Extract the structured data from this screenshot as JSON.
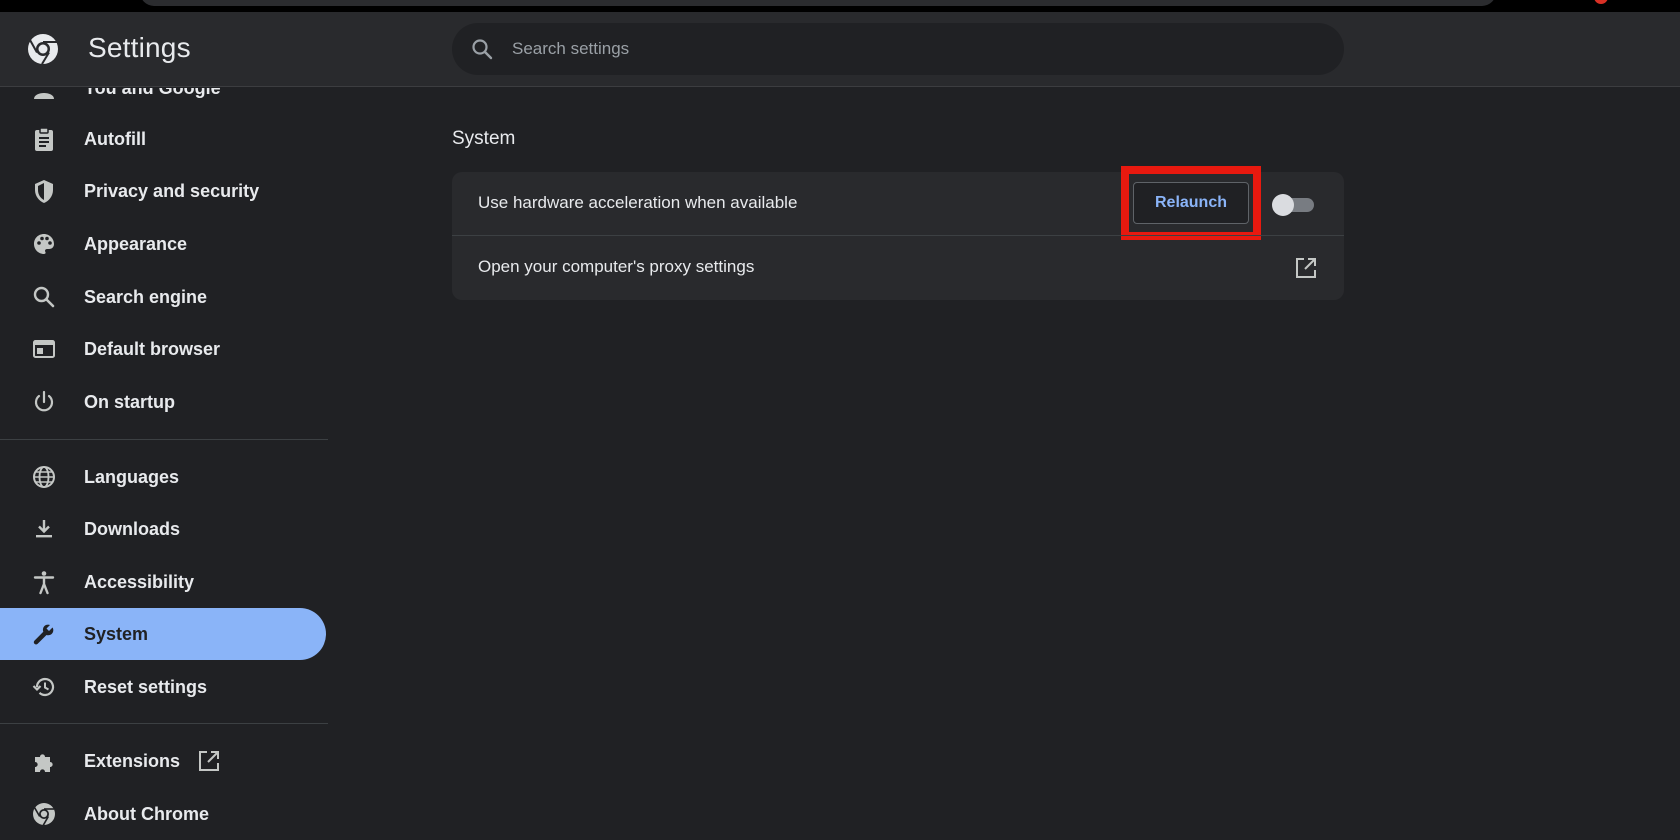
{
  "header": {
    "title": "Settings",
    "search_placeholder": "Search settings"
  },
  "sidebar": {
    "items": [
      {
        "label": "You and Google",
        "icon": "person-icon"
      },
      {
        "label": "Autofill",
        "icon": "clipboard-icon"
      },
      {
        "label": "Privacy and security",
        "icon": "shield-icon"
      },
      {
        "label": "Appearance",
        "icon": "palette-icon"
      },
      {
        "label": "Search engine",
        "icon": "search-icon"
      },
      {
        "label": "Default browser",
        "icon": "browser-window-icon"
      },
      {
        "label": "On startup",
        "icon": "power-icon"
      },
      {
        "label": "Languages",
        "icon": "globe-icon"
      },
      {
        "label": "Downloads",
        "icon": "download-icon"
      },
      {
        "label": "Accessibility",
        "icon": "accessibility-icon"
      },
      {
        "label": "System",
        "icon": "wrench-icon",
        "active": true
      },
      {
        "label": "Reset settings",
        "icon": "history-icon"
      },
      {
        "label": "Extensions",
        "icon": "puzzle-icon"
      },
      {
        "label": "About Chrome",
        "icon": "chrome-icon"
      }
    ]
  },
  "main": {
    "section_title": "System",
    "rows": [
      {
        "label": "Use hardware acceleration when available",
        "button": "Relaunch",
        "toggle_on": false
      },
      {
        "label": "Open your computer's proxy settings"
      }
    ]
  },
  "colors": {
    "background": "#202124",
    "header": "#292a2d",
    "accent": "#8ab4f8",
    "highlight": "#e8190f"
  }
}
